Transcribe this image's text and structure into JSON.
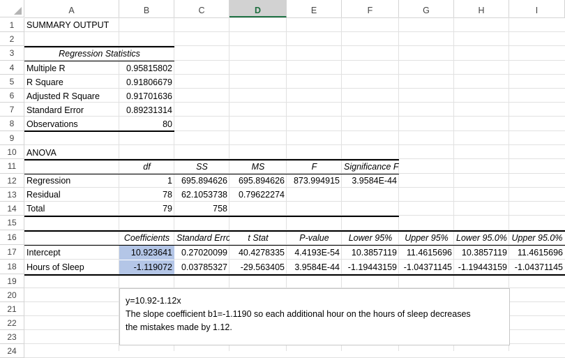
{
  "columns": [
    "A",
    "B",
    "C",
    "D",
    "E",
    "F",
    "G",
    "H",
    "I"
  ],
  "selected_column": "D",
  "rows": [
    "1",
    "2",
    "3",
    "4",
    "5",
    "6",
    "7",
    "8",
    "9",
    "10",
    "11",
    "12",
    "13",
    "14",
    "15",
    "16",
    "17",
    "18",
    "19",
    "20",
    "21",
    "22",
    "23",
    "24"
  ],
  "summary_title": "SUMMARY OUTPUT",
  "reg_stats": {
    "header": "Regression Statistics",
    "labels": [
      "Multiple R",
      "R Square",
      "Adjusted R Square",
      "Standard Error",
      "Observations"
    ],
    "values": [
      "0.95815802",
      "0.91806679",
      "0.91701636",
      "0.89231314",
      "80"
    ]
  },
  "anova": {
    "title": "ANOVA",
    "headers": [
      "df",
      "SS",
      "MS",
      "F",
      "Significance F"
    ],
    "rows": [
      {
        "label": "Regression",
        "df": "1",
        "ss": "695.894626",
        "ms": "695.894626",
        "f": "873.994915",
        "sig": "3.9584E-44"
      },
      {
        "label": "Residual",
        "df": "78",
        "ss": "62.1053738",
        "ms": "0.79622274",
        "f": "",
        "sig": ""
      },
      {
        "label": "Total",
        "df": "79",
        "ss": "758",
        "ms": "",
        "f": "",
        "sig": ""
      }
    ]
  },
  "coef": {
    "headers": [
      "Coefficients",
      "Standard Erro",
      "t Stat",
      "P-value",
      "Lower 95%",
      "Upper 95%",
      "Lower 95.0%",
      "Upper 95.0%"
    ],
    "rows": [
      {
        "label": "Intercept",
        "vals": [
          "10.923641",
          "0.27020099",
          "40.4278335",
          "4.4193E-54",
          "10.3857119",
          "11.4615696",
          "10.3857119",
          "11.4615696"
        ]
      },
      {
        "label": "Hours of Sleep",
        "vals": [
          "-1.119072",
          "0.03785327",
          "-29.563405",
          "3.9584E-44",
          "-1.19443159",
          "-1.04371145",
          "-1.19443159",
          "-1.04371145"
        ]
      }
    ]
  },
  "textbox": {
    "line1": "y=10.92-1.12x",
    "line2": "The slope coefficient b1=-1.1190 so each additional hour on the hours of sleep decreases",
    "line3": "the mistakes made by 1.12."
  },
  "colors": {
    "highlight": "#b4c6e7",
    "selected_header": "#d2d2d2",
    "accent": "#217346"
  }
}
